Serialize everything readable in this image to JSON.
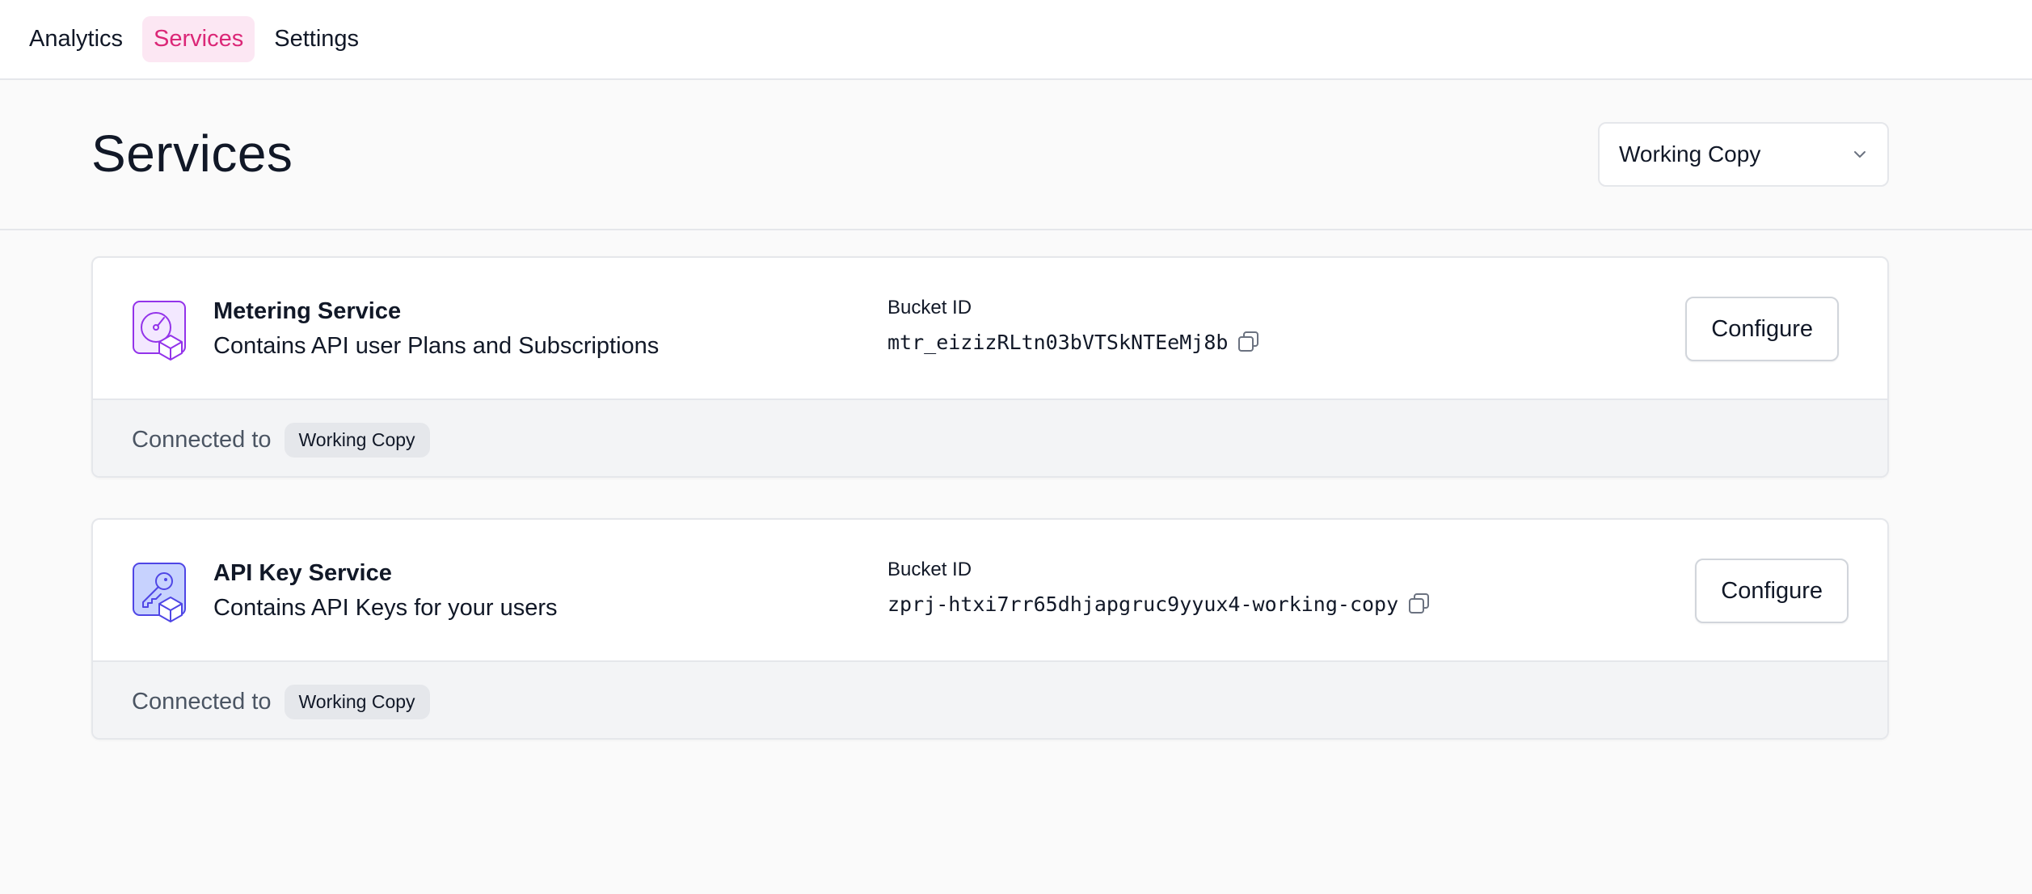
{
  "nav": {
    "tabs": [
      {
        "label": "Analytics",
        "active": false
      },
      {
        "label": "Services",
        "active": true
      },
      {
        "label": "Settings",
        "active": false
      }
    ]
  },
  "header": {
    "title": "Services",
    "environment_select": {
      "value": "Working Copy"
    }
  },
  "services": [
    {
      "name": "Metering Service",
      "description": "Contains API user Plans and Subscriptions",
      "icon": "metering-gauge-icon",
      "bucket_label": "Bucket ID",
      "bucket_id": "mtr_eizizRLtn03bVTSkNTEeMj8b",
      "configure_label": "Configure",
      "connected_label": "Connected to",
      "connected_env": "Working Copy",
      "accent": "#9333ea"
    },
    {
      "name": "API Key Service",
      "description": "Contains API Keys for your users",
      "icon": "api-key-icon",
      "bucket_label": "Bucket ID",
      "bucket_id": "zprj-htxi7rr65dhjapgruc9yyux4-working-copy",
      "configure_label": "Configure",
      "connected_label": "Connected to",
      "connected_env": "Working Copy",
      "accent": "#4f46e5"
    }
  ],
  "colors": {
    "active_tab_bg": "#fce7f3",
    "active_tab_text": "#db2777",
    "page_bg": "#fafafa"
  }
}
